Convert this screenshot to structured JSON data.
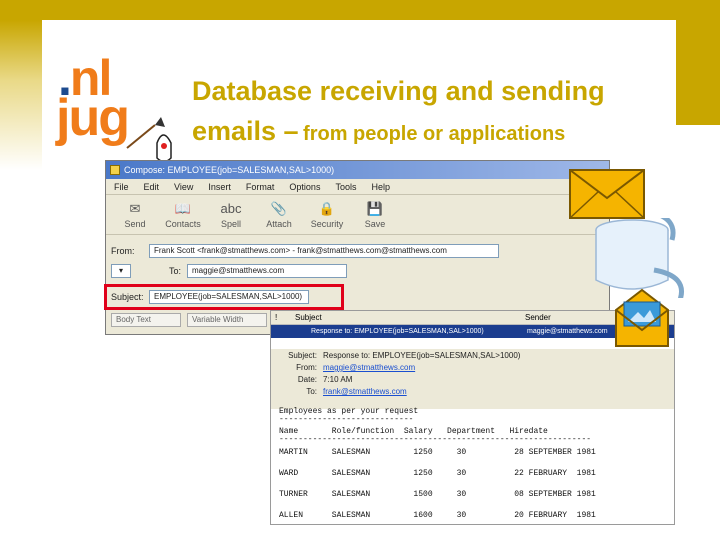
{
  "slide": {
    "title_line1": "Database receiving and sending",
    "title_line2_big": "emails –",
    "title_line2_small": "from people or applications",
    "accent_color": "#c8a600"
  },
  "logo": {
    "nl": "nl",
    "jug": "jug"
  },
  "compose": {
    "window_title": "Compose: EMPLOYEE(job=SALESMAN,SAL>1000)",
    "menu": [
      "File",
      "Edit",
      "View",
      "Insert",
      "Format",
      "Options",
      "Tools",
      "Help"
    ],
    "toolbar": [
      "Send",
      "Contacts",
      "Spell",
      "Attach",
      "Security",
      "Save"
    ],
    "from_label": "From:",
    "from_value": "Frank Scott <frank@stmatthews.com> - frank@stmatthews.com@stmatthews.com",
    "to_label": "To:",
    "to_value": "maggie@stmatthews.com",
    "subject_label": "Subject:",
    "subject_value": "EMPLOYEE(job=SALESMAN,SAL>1000)",
    "format_font": "Body Text",
    "format_width": "Variable Width"
  },
  "reply": {
    "columns": [
      "!",
      "Subject",
      "Sender"
    ],
    "selected_subject": "Response to: EMPLOYEE(job=SALESMAN,SAL>1000)",
    "selected_sender": "maggie@stmatthews.com",
    "subject_key": "Subject:",
    "subject_val": "Response to: EMPLOYEE(job=SALESMAN,SAL>1000)",
    "from_key": "From:",
    "from_val": "maggie@stmatthews.com",
    "date_key": "Date:",
    "date_val": "7:10 AM",
    "to_key": "To:",
    "to_val": "frank@stmatthews.com",
    "intro": "Employees as per your request",
    "underline": "----------------------------",
    "header": "Name       Role/function  Salary   Department   Hiredate",
    "divider": "-----------------------------------------------------------------",
    "rows": [
      "MARTIN     SALESMAN         1250     30          28 SEPTEMBER 1981",
      "WARD       SALESMAN         1250     30          22 FEBRUARY  1981",
      "TURNER     SALESMAN         1500     30          08 SEPTEMBER 1981",
      "ALLEN      SALESMAN         1600     30          20 FEBRUARY  1981"
    ]
  }
}
